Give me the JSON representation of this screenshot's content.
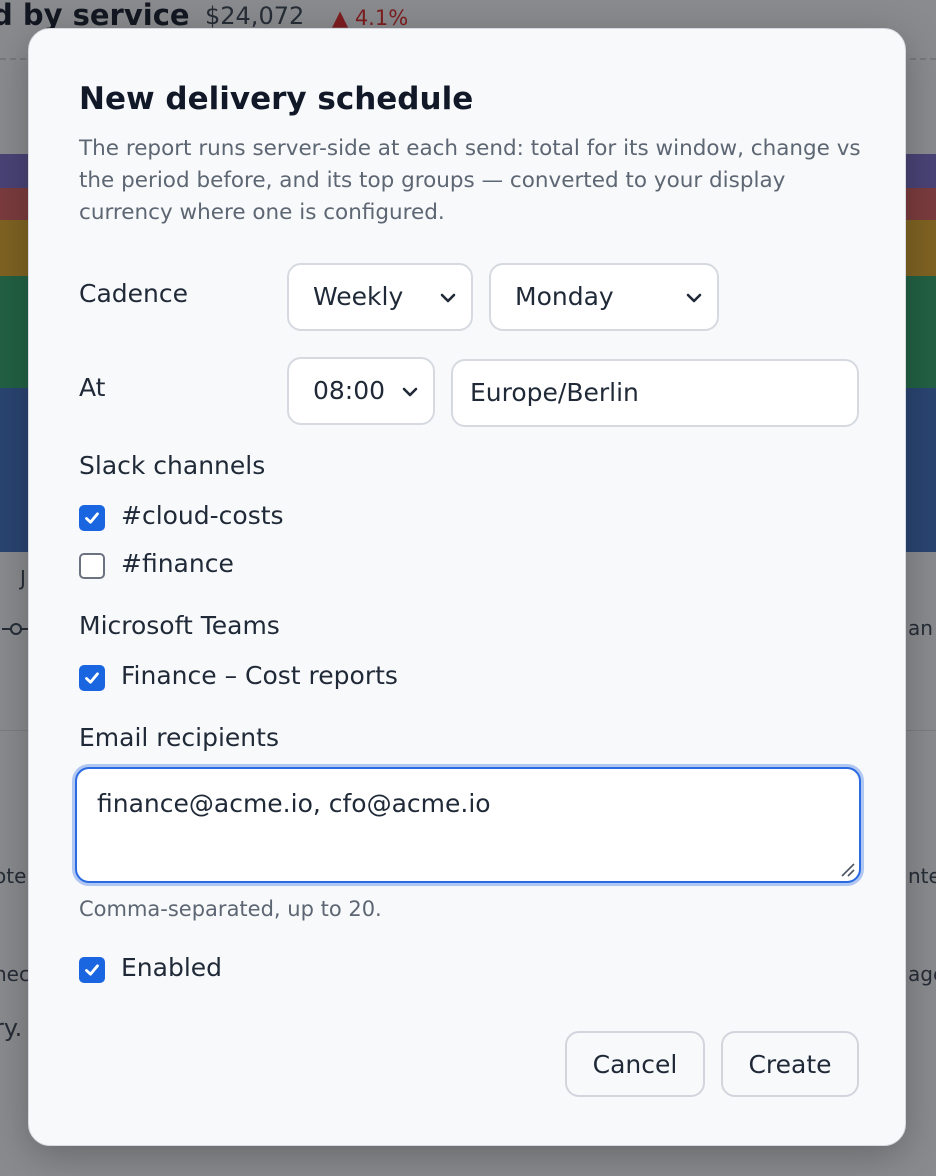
{
  "background": {
    "title_fragment": "d by service",
    "total": "$24,072",
    "delta": "▲ 4.1%",
    "axis_label_fragment": "J",
    "right_fragment_1": "an",
    "right_fragment_2": "nte",
    "right_fragment_3": "age",
    "left_fragment_1": "ote",
    "left_fragment_2": "hec",
    "left_fragment_3": "ry."
  },
  "modal": {
    "title": "New delivery schedule",
    "description": "The report runs server-side at each send: total for its window, change vs the period before, and its top groups — converted to your display currency where one is configured.",
    "cadence": {
      "label": "Cadence",
      "frequency": "Weekly",
      "day": "Monday"
    },
    "at": {
      "label": "At",
      "time": "08:00",
      "timezone": "Europe/Berlin"
    },
    "slack": {
      "label": "Slack channels",
      "channels": [
        {
          "name": "#cloud-costs",
          "checked": true
        },
        {
          "name": "#finance",
          "checked": false
        }
      ]
    },
    "teams": {
      "label": "Microsoft Teams",
      "channels": [
        {
          "name": "Finance – Cost reports",
          "checked": true
        }
      ]
    },
    "email": {
      "label": "Email recipients",
      "value": "finance@acme.io, cfo@acme.io",
      "hint": "Comma-separated, up to 20."
    },
    "enabled": {
      "label": "Enabled",
      "checked": true
    },
    "buttons": {
      "cancel": "Cancel",
      "create": "Create"
    }
  },
  "colors": {
    "accent": "#1a66e0",
    "focus_ring": "#2a6ae3",
    "delta_up": "#dc2626",
    "chart_bands": [
      "#7c6bc9",
      "#d95f5f",
      "#e0a92b",
      "#2fa66a",
      "#3e6fc2"
    ]
  }
}
